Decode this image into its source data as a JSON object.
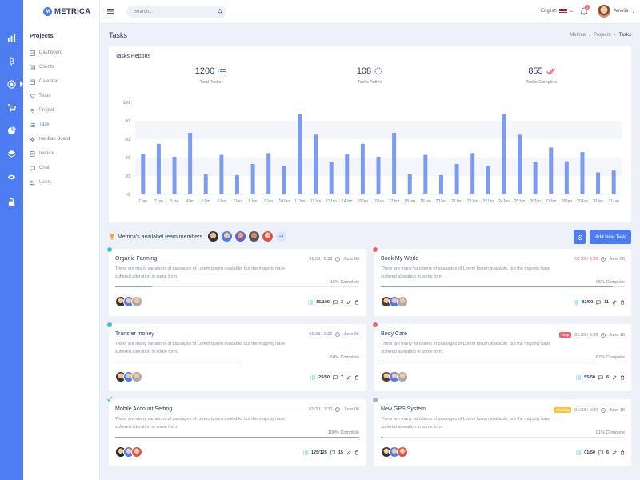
{
  "app": {
    "name": "METRICA",
    "logo_glyph": "M"
  },
  "colors": {
    "accent": "#4d7cf0",
    "bar": "#7b9cf1",
    "danger": "#f1646c",
    "warning": "#f6c344",
    "cyan": "#3ec0dc",
    "teal": "#1ecab8"
  },
  "rail": {
    "icons": [
      "analytics-icon",
      "bitcoin-icon",
      "projects-icon",
      "cart-icon",
      "pie-chart-icon",
      "layers-icon",
      "eye-icon",
      "lock-icon"
    ]
  },
  "sidebar": {
    "title": "Projects",
    "items": [
      {
        "label": "Dashboard",
        "icon": "dashboard-icon"
      },
      {
        "label": "Clients",
        "icon": "clients-icon"
      },
      {
        "label": "Calendar",
        "icon": "calendar-icon"
      },
      {
        "label": "Team",
        "icon": "team-icon"
      },
      {
        "label": "Project",
        "icon": "project-icon"
      },
      {
        "label": "Task",
        "icon": "task-icon"
      },
      {
        "label": "Kanban Board",
        "icon": "kanban-icon"
      },
      {
        "label": "Invoice",
        "icon": "invoice-icon"
      },
      {
        "label": "Chat",
        "icon": "chat-icon"
      },
      {
        "label": "Users",
        "icon": "users-icon"
      }
    ]
  },
  "topbar": {
    "search_placeholder": "Search...",
    "language": "English",
    "notification_count": "3",
    "user_name": "Amelia"
  },
  "page": {
    "title": "Tasks",
    "breadcrumb": [
      "Metrica",
      "Projects",
      "Tasks"
    ]
  },
  "reports": {
    "title": "Tasks Reports",
    "stats": [
      {
        "value": "1200",
        "label": "Total Tasks",
        "icon": "list-icon"
      },
      {
        "value": "108",
        "label": "Tasks Active",
        "icon": "spinner-icon"
      },
      {
        "value": "855",
        "label": "Tasks Complete",
        "icon": "double-check-icon"
      }
    ]
  },
  "chart_data": {
    "type": "bar",
    "categories": [
      "1Jan",
      "2Jan",
      "3Jan",
      "4Jan",
      "5Jan",
      "6Jan",
      "7Jan",
      "8Jan",
      "9Jan",
      "10Jan",
      "11Jan",
      "12Jan",
      "13Jan",
      "14Jan",
      "15Jan",
      "16Jan",
      "17Jan",
      "18Jan",
      "19Jan",
      "20Jan",
      "21Jan",
      "22Jan",
      "23Jan",
      "24Jan",
      "25Jan",
      "26Jan",
      "27Jan",
      "28Jan",
      "29Jan",
      "30Jan",
      "31Jan"
    ],
    "values": [
      44,
      55,
      41,
      67,
      22,
      43,
      21,
      33,
      45,
      31,
      87,
      65,
      35,
      44,
      55,
      41,
      67,
      22,
      43,
      21,
      33,
      45,
      31,
      87,
      65,
      35,
      51,
      36,
      46,
      24,
      26
    ],
    "ylim": [
      0,
      100
    ],
    "yticks": [
      0,
      20,
      40,
      60,
      80,
      100
    ],
    "grid": "alternating horizontal bands"
  },
  "team": {
    "label": "Metrica's availabel team members.",
    "more": "+4",
    "add_button": "Add New Task"
  },
  "tasks": [
    {
      "name": "Organic Farming",
      "time": "01:33 / 9:30",
      "time_late": false,
      "date": "June 06",
      "tag": "",
      "desc": "There are many variations of passages of Lorem Ipsum available, but the majority have suffered alteration in some form.",
      "percent": 15,
      "percent_label": "15% Complete",
      "count": "15/100",
      "comments": "3",
      "dot": "#3ec0dc",
      "dot_shape": "dot"
    },
    {
      "name": "Book My World",
      "time": "10:33 / 9:30",
      "time_late": true,
      "date": "June 06",
      "tag": "",
      "desc": "There are many variations of passages of Lorem Ipsum available, but the majority have suffered alteration in some form.",
      "percent": 95,
      "percent_label": "95% Complete",
      "count": "82/90",
      "comments": "11",
      "dot": "#f1646c",
      "dot_shape": "dot"
    },
    {
      "name": "Transfer money",
      "time": "01:33 / 9:30",
      "time_late": false,
      "date": "June 06",
      "tag": "",
      "desc": "There are many variations of passages of Lorem Ipsum available, but the majority have suffered alteration in some form.",
      "percent": 50,
      "percent_label": "50% Complete",
      "count": "25/50",
      "comments": "7",
      "dot": "#3ec0dc",
      "dot_shape": "dot"
    },
    {
      "name": "Body Care",
      "time": "01:33 / 9:30",
      "time_late": false,
      "date": "June 18",
      "tag": "Stop",
      "tag_color": "#f1646c",
      "desc": "There are many variations of passages of Lorem Ipsum available, but the majority have suffered alteration in some form.",
      "percent": 87,
      "percent_label": "87% Complete",
      "count": "55/50",
      "comments": "6",
      "dot": "#f1646c",
      "dot_shape": "dot"
    },
    {
      "name": "Mobile Account Setting",
      "time": "01:20 / 1:30",
      "time_late": false,
      "date": "June 06",
      "tag": "",
      "desc": "There are many variations of passages of Lorem Ipsum available, but the majority have suffered alteration in some form.",
      "percent": 100,
      "percent_label": "100% Complete",
      "count": "125/125",
      "comments": "15",
      "dot": "#1ecab8",
      "dot_shape": "check"
    },
    {
      "name": "New GPS System",
      "time": "01:33 / 9:30",
      "time_late": false,
      "date": "June 18",
      "tag": "Pending",
      "tag_color": "#f6c344",
      "desc": "There are many variations of passages of Lorem Ipsum available, but the majority have suffered alteration in some form.",
      "percent": 1,
      "percent_label": "01% Complete",
      "count": "01/50",
      "comments": "6",
      "dot": "#a3acd8",
      "dot_shape": "dot"
    }
  ]
}
